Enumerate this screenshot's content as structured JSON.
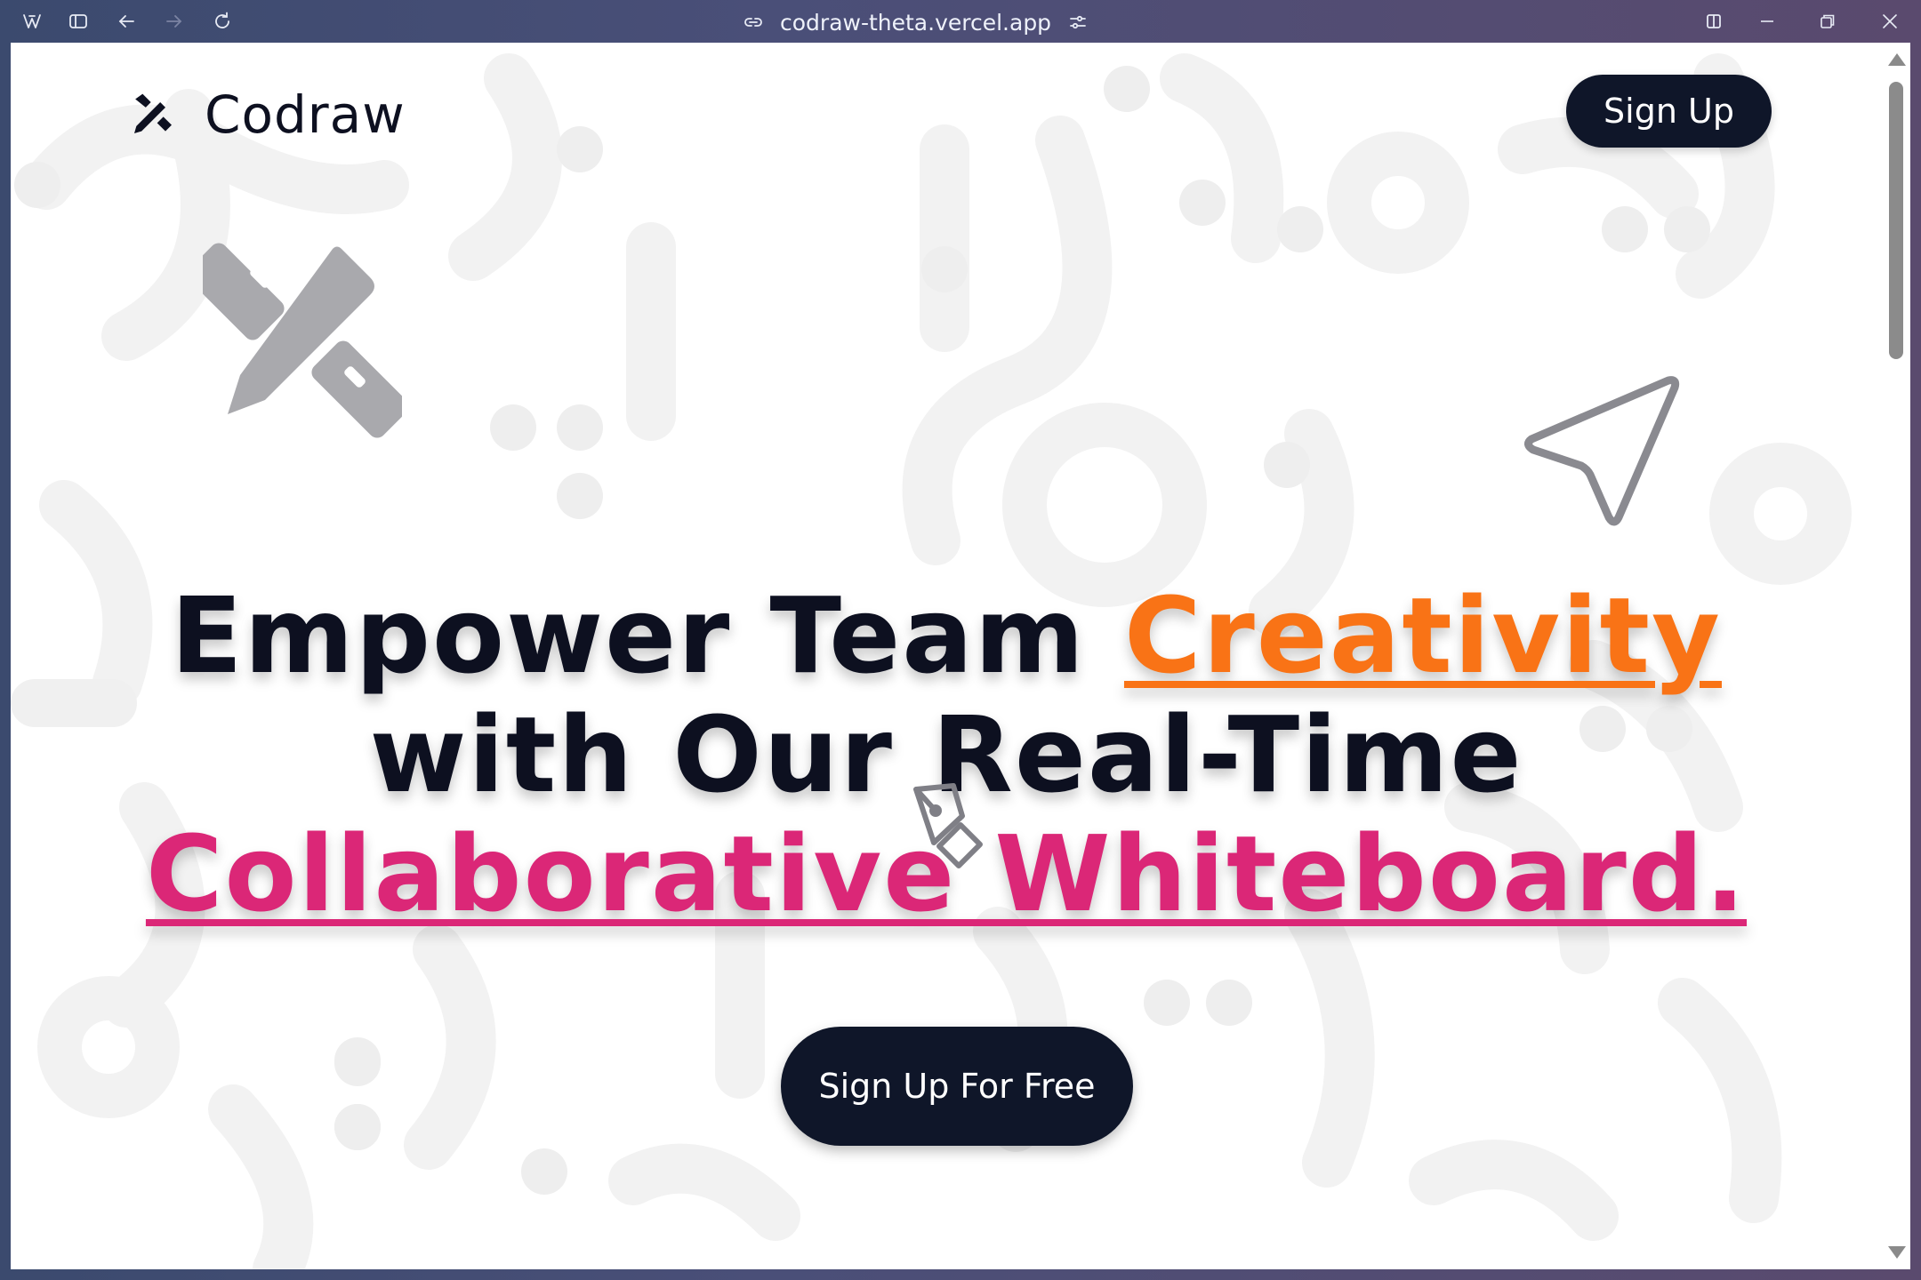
{
  "browser": {
    "url": "codraw-theta.vercel.app",
    "icons": [
      "app-logo-icon",
      "sidebar-toggle-icon",
      "back-icon",
      "forward-icon",
      "reload-icon",
      "link-icon",
      "site-settings-icon",
      "split-view-icon",
      "minimize-icon",
      "restore-icon",
      "close-icon"
    ]
  },
  "header": {
    "brand": "Codraw",
    "signup_label": "Sign Up"
  },
  "hero": {
    "line1_a": "Empower Team ",
    "line1_b": "Creativity",
    "line2": "with Our Real-Time",
    "line3": "Collaborative Whiteboard.",
    "cta_label": "Sign Up For Free"
  },
  "colors": {
    "accent_orange": "#f97316",
    "accent_pink": "#db2777",
    "button_dark": "#0f1629",
    "text_dark": "#0d1020"
  }
}
